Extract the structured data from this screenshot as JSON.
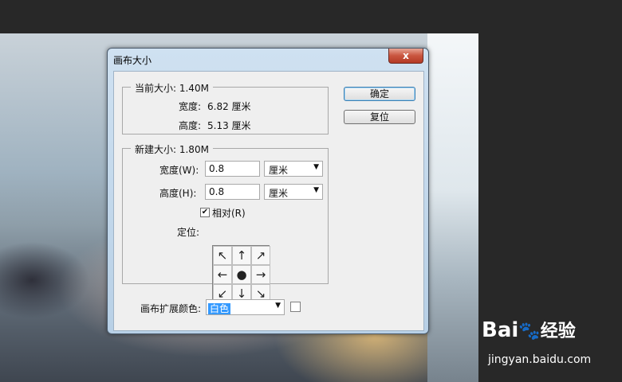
{
  "dialog": {
    "title": "画布大小",
    "close_label": "x"
  },
  "current_size": {
    "title": "当前大小: 1.40M",
    "width_label": "宽度:",
    "width_value": "6.82 厘米",
    "height_label": "高度:",
    "height_value": "5.13 厘米"
  },
  "new_size": {
    "title": "新建大小: 1.80M",
    "width_label": "宽度(W):",
    "width_value": "0.8",
    "width_unit": "厘米",
    "height_label": "高度(H):",
    "height_value": "0.8",
    "height_unit": "厘米",
    "relative_label": "相对(R)",
    "relative_checked": true,
    "anchor_label": "定位:",
    "anchor_cells": [
      "↖",
      "↑",
      "↗",
      "←",
      "●",
      "→",
      "↙",
      "↓",
      "↘"
    ]
  },
  "canvas_ext_color": {
    "label": "画布扩展颜色:",
    "value": "白色",
    "swatch_color": "#ffffff"
  },
  "buttons": {
    "ok": "确定",
    "reset": "复位"
  },
  "watermark": {
    "brand": "Bai",
    "brand2": "经验",
    "url": "jingyan.baidu.com"
  }
}
